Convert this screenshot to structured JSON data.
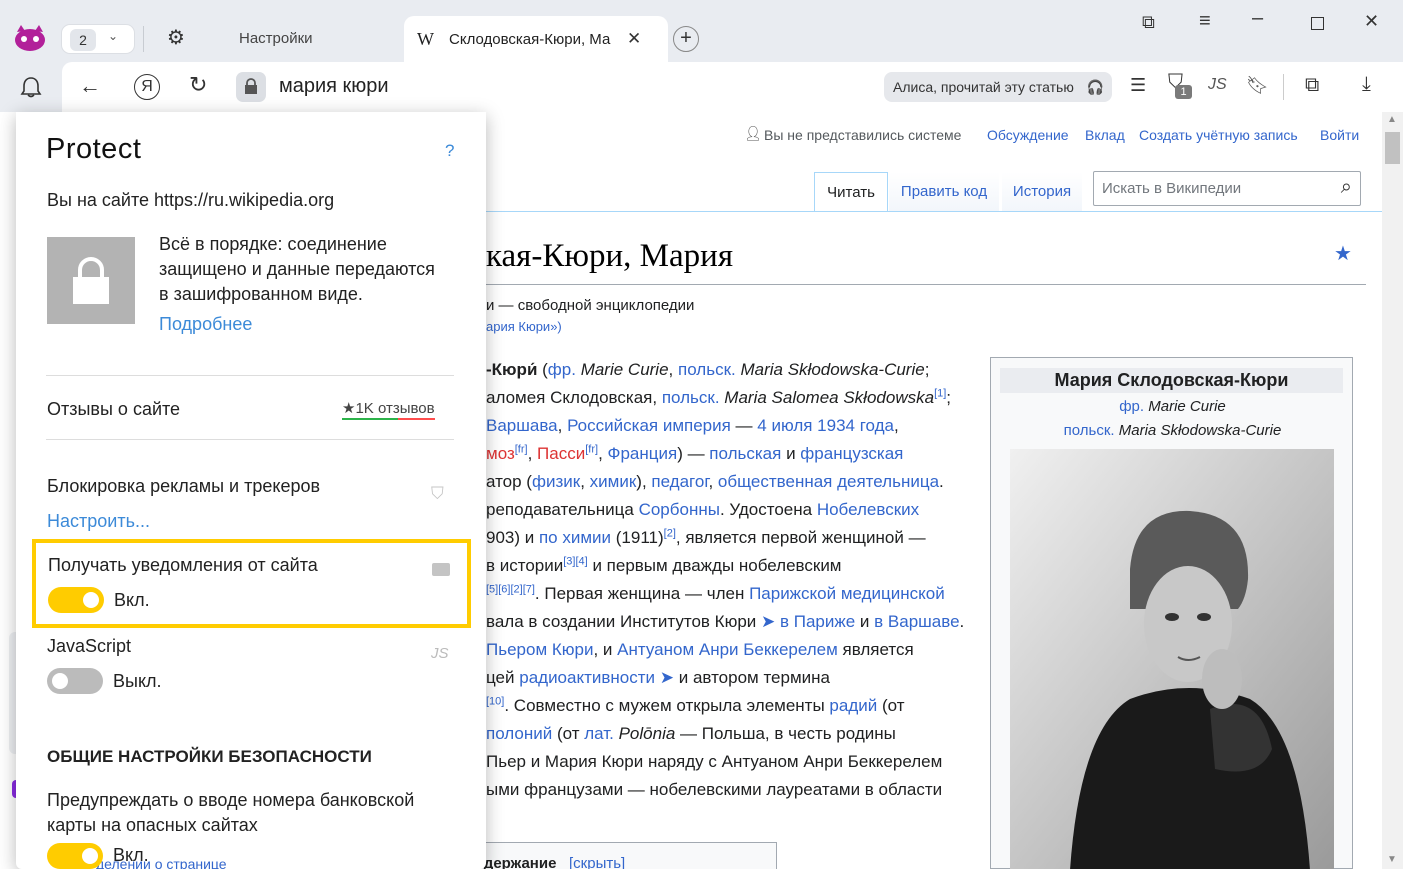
{
  "tabs": {
    "count": "2",
    "settings_tab": "Настройки",
    "active_tab": "Склодовская-Кюри, Ма",
    "active_favicon": "W"
  },
  "address": {
    "url_text": "мария кюри",
    "alice_label": "Алиса, прочитай эту статью",
    "badge_count": "1"
  },
  "wiki": {
    "user_links": {
      "not_logged": "Вы не представились системе",
      "discussion": "Обсуждение",
      "contrib": "Вклад",
      "create": "Создать учётную запись",
      "login": "Войти"
    },
    "tabs": {
      "read": "Читать",
      "edit": "Править код",
      "history": "История"
    },
    "search_placeholder": "Искать в Википедии",
    "title": "кая-Кюри, Мария",
    "from": "и — свободной энциклопедии",
    "redirect": "ария Кюри»)",
    "infobox": {
      "title": "Мария Склодовская-Кюри",
      "fr_label": "фр.",
      "fr_name": "Marie Curie",
      "pl_label": "польск.",
      "pl_name": "Maria Skłodowska-Curie"
    },
    "toc": {
      "label": "Содержание",
      "hide": "[скрыть]"
    }
  },
  "popup": {
    "title": "Protect",
    "help": "?",
    "site_line": "Вы на сайте https://ru.wikipedia.org",
    "secure_text_1": "Всё в порядке: соединение",
    "secure_text_2": "защищено и данные передаются",
    "secure_text_3": "в зашифрованном виде.",
    "more_link": "Подробнее",
    "reviews_label": "Отзывы о сайте",
    "reviews_count": "★1K отзывов",
    "adblock_label": "Блокировка рекламы и трекеров",
    "configure_link": "Настроить...",
    "notif_label": "Получать уведомления от сайта",
    "notif_state": "Вкл.",
    "js_label": "JavaScript",
    "js_state": "Выкл.",
    "section_title": "ОБЩИЕ НАСТРОЙКИ БЕЗОПАСНОСТИ",
    "bank_label_1": "Предупреждать о вводе номера банковской",
    "bank_label_2": "карты на опасных сайтах",
    "bank_state": "Вкл.",
    "peek_text": "делении о странице"
  },
  "colors": {
    "accent_yellow": "#ffcc00",
    "wiki_link": "#3366cc",
    "chrome_bg": "#e9ecf1",
    "toggle_off": "#bbbbbb"
  }
}
